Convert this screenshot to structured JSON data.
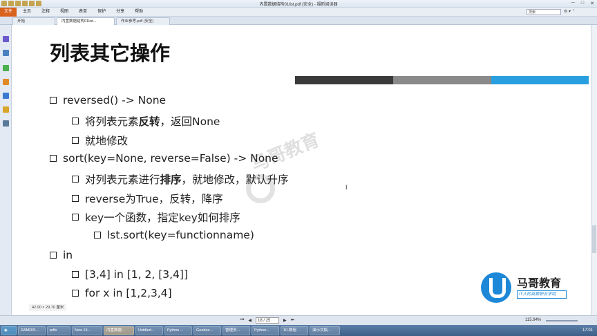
{
  "window": {
    "title": "内置数据结构01list.pdf (安全) - 福昕阅读器",
    "search_placeholder": "搜索"
  },
  "menu": {
    "file": "文件",
    "items": [
      "主页",
      "注释",
      "视图",
      "表单",
      "保护",
      "分享",
      "帮助"
    ]
  },
  "tabs": [
    "开始",
    "内置数据结构01list...",
    "作业参考.pdf (安全)"
  ],
  "slide": {
    "title": "列表其它操作",
    "bar_colors": [
      "#3a3a3a",
      "#8a8a8a",
      "#2a9fe0"
    ],
    "bullets": [
      {
        "level": 1,
        "text": "reversed() -> None"
      },
      {
        "level": 2,
        "pre": "将列表元素",
        "bold": "反转",
        "post": "，返回None"
      },
      {
        "level": 2,
        "text": "就地修改"
      },
      {
        "level": 1,
        "text": "sort(key=None, reverse=False) -> None"
      },
      {
        "level": 2,
        "pre": "对列表元素进行",
        "bold": "排序",
        "post": "，就地修改，默认升序"
      },
      {
        "level": 2,
        "text": "reverse为True，反转，降序"
      },
      {
        "level": 2,
        "text": "key一个函数，指定key如何排序"
      },
      {
        "level": 3,
        "text": "lst.sort(key=functionname)"
      },
      {
        "level": 1,
        "text": "in"
      },
      {
        "level": 2,
        "text": "[3,4] in [1, 2, [3,4]]"
      },
      {
        "level": 2,
        "text": "for x in [1,2,3,4]"
      }
    ],
    "watermark": "马哥教育",
    "logo_name": "马哥教育",
    "logo_slogan": "IT人的高薪职业学院"
  },
  "status": {
    "page_size": "42.00 × 29.70 厘米",
    "page_indicator": "18 / 25",
    "zoom": "115.94%"
  },
  "taskbar": {
    "items": [
      "RAMDIS...",
      "pdfs",
      "New 15...",
      "内置数据...",
      "Untitled...",
      "Python ...",
      "Geodes...",
      "管理员...",
      "Python...",
      "10-数组",
      "演示文稿..."
    ],
    "active_index": 3,
    "clock": "17:01"
  }
}
